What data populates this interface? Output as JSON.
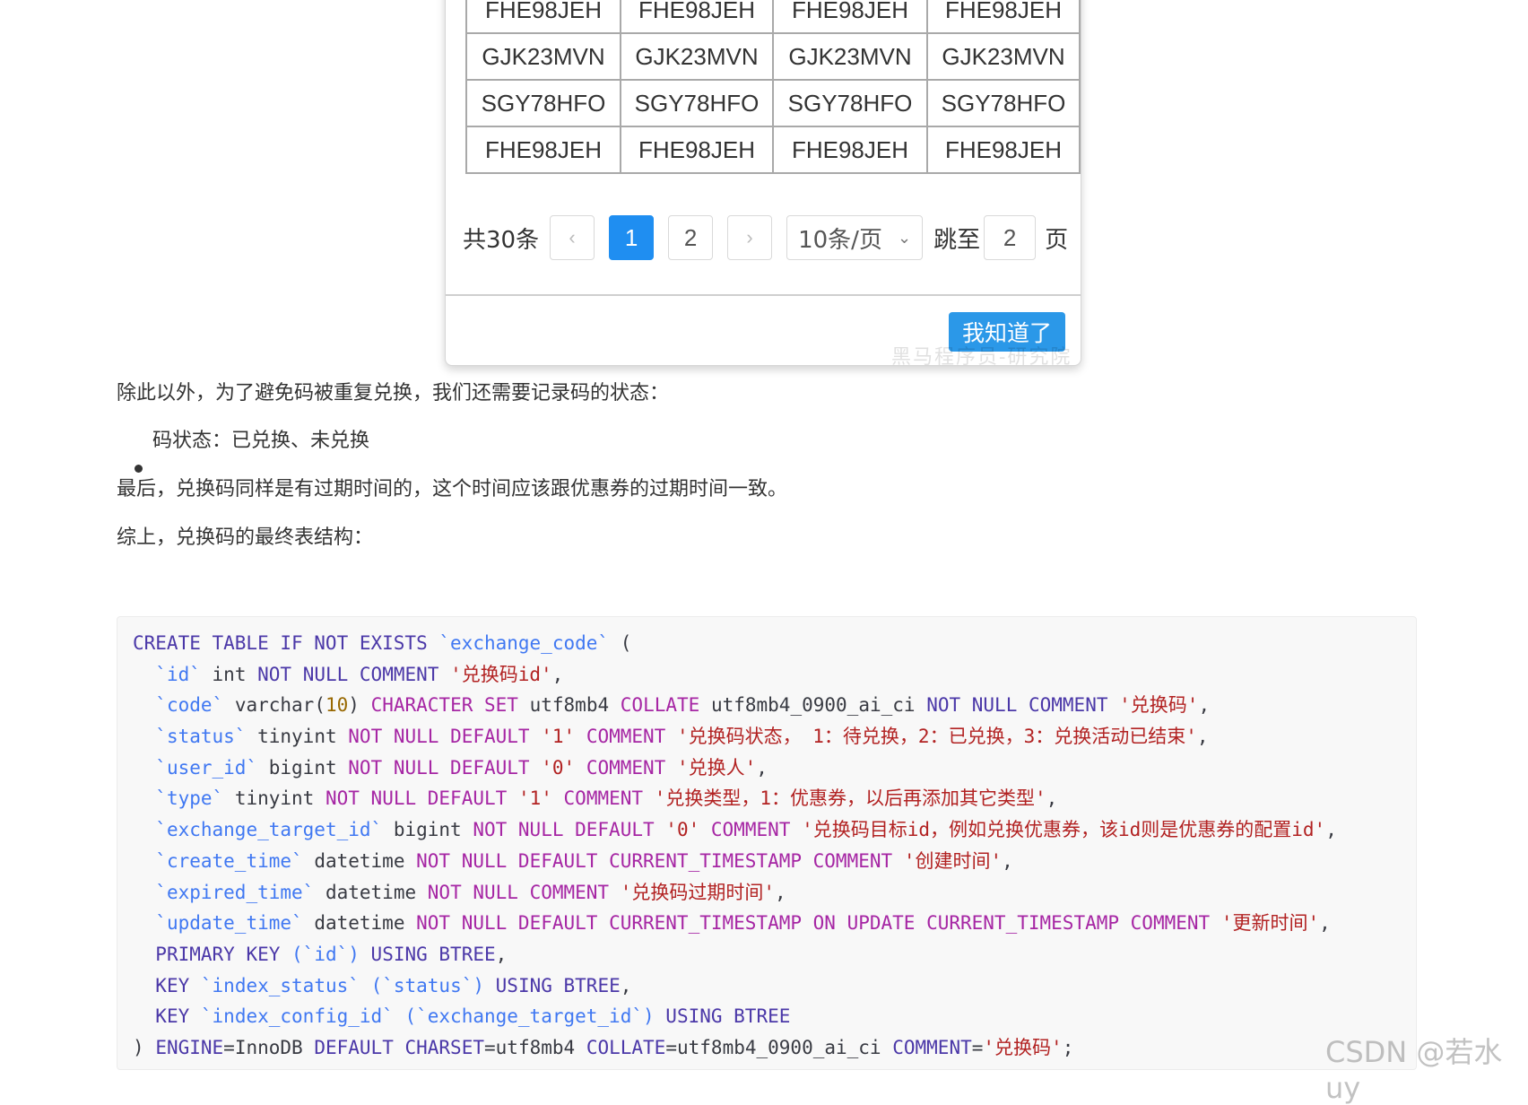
{
  "modal": {
    "table_rows": [
      [
        "FHE98JEH",
        "FHE98JEH",
        "FHE98JEH",
        "FHE98JEH"
      ],
      [
        "GJK23MVN",
        "GJK23MVN",
        "GJK23MVN",
        "GJK23MVN"
      ],
      [
        "SGY78HFO",
        "SGY78HFO",
        "SGY78HFO",
        "SGY78HFO"
      ],
      [
        "FHE98JEH",
        "FHE98JEH",
        "FHE98JEH",
        "FHE98JEH"
      ]
    ],
    "pager": {
      "total": "共30条",
      "prev": "‹",
      "page1": "1",
      "page2": "2",
      "next": "›",
      "page_size": "10条/页",
      "jump_label": "跳至",
      "jump_value": "2",
      "page_unit": "页"
    },
    "ok_button": "我知道了",
    "image_watermark": "黑马程序员-研究院"
  },
  "article": {
    "p1": "除此以外，为了避免码被重复兑换，我们还需要记录码的状态：",
    "bullet1": "码状态：已兑换、未兑换",
    "p2": "最后，兑换码同样是有过期时间的，这个时间应该跟优惠券的过期时间一致。",
    "p3": "综上，兑换码的最终表结构："
  },
  "code": {
    "l1_a": "CREATE TABLE IF NOT EXISTS",
    "l1_b": "`exchange_code`",
    "l1_c": "(",
    "l2_id": "`id`",
    "l2_type": "int",
    "l2_kw": "NOT NULL COMMENT",
    "l2_str": "'兑换码id'",
    "l3_id": "`code`",
    "l3_type": "varchar",
    "l3_num": "10",
    "l3_kw1": "CHARACTER SET",
    "l3_v1": "utf8mb4",
    "l3_kw2": "COLLATE",
    "l3_v2": "utf8mb4_0900_ai_ci",
    "l3_kw3": "NOT NULL COMMENT",
    "l3_str": "'兑换码'",
    "l4_id": "`status`",
    "l4_type": "tinyint",
    "l4_kw": "NOT NULL DEFAULT",
    "l4_def": "'1'",
    "l4_kw2": "COMMENT",
    "l4_str": "'兑换码状态， 1：待兑换，2：已兑换，3：兑换活动已结束'",
    "l5_id": "`user_id`",
    "l5_type": "bigint",
    "l5_kw": "NOT NULL DEFAULT",
    "l5_def": "'0'",
    "l5_kw2": "COMMENT",
    "l5_str": "'兑换人'",
    "l6_id": "`type`",
    "l6_type": "tinyint",
    "l6_kw": "NOT NULL DEFAULT",
    "l6_def": "'1'",
    "l6_kw2": "COMMENT",
    "l6_str": "'兑换类型，1：优惠券，以后再添加其它类型'",
    "l7_id": "`exchange_target_id`",
    "l7_type": "bigint",
    "l7_kw": "NOT NULL DEFAULT",
    "l7_def": "'0'",
    "l7_kw2": "COMMENT",
    "l7_str": "'兑换码目标id，例如兑换优惠券，该id则是优惠券的配置id'",
    "l8_id": "`create_time`",
    "l8_type": "datetime",
    "l8_kw": "NOT NULL DEFAULT CURRENT_TIMESTAMP COMMENT",
    "l8_str": "'创建时间'",
    "l9_id": "`expired_time`",
    "l9_type": "datetime",
    "l9_kw": "NOT NULL COMMENT",
    "l9_str": "'兑换码过期时间'",
    "l10_id": "`update_time`",
    "l10_type": "datetime",
    "l10_kw": "NOT NULL DEFAULT CURRENT_TIMESTAMP ON UPDATE CURRENT_TIMESTAMP COMMENT",
    "l10_str": "'更新时间'",
    "l11_kw": "PRIMARY KEY",
    "l11_b": "(`id`)",
    "l11_kw2": "USING BTREE",
    "l12_kw": "KEY",
    "l12_id": "`index_status`",
    "l12_b": "(`status`)",
    "l12_kw2": "USING BTREE",
    "l13_kw": "KEY",
    "l13_id": "`index_config_id`",
    "l13_b": "(`exchange_target_id`)",
    "l13_kw2": "USING BTREE",
    "l14_a": ")",
    "l14_kw1": "ENGINE",
    "l14_v1": "InnoDB",
    "l14_kw2": "DEFAULT CHARSET",
    "l14_v2": "utf8mb4",
    "l14_kw3": "COLLATE",
    "l14_v3": "utf8mb4_0900_ai_ci",
    "l14_kw4": "COMMENT",
    "l14_str": "'兑换码'"
  },
  "watermark": "CSDN @若水uy"
}
